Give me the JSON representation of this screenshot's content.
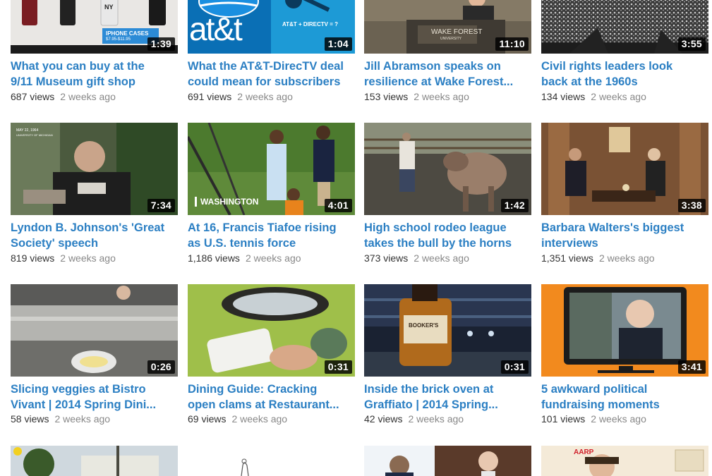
{
  "videos": [
    {
      "title_1": "What you can buy at the",
      "title_2": "9/11 Museum gift shop",
      "views": "687 views",
      "ago": "2 weeks ago",
      "duration": "1:39",
      "overlay": "IPHONE CASES",
      "overlay_sub": "$7.95-$11.95",
      "overlay_2": "NY"
    },
    {
      "title_1": "What the AT&T-DirecTV deal",
      "title_2": "could mean for subscribers",
      "views": "691 views",
      "ago": "2 weeks ago",
      "duration": "1:04",
      "overlay": "at&t",
      "overlay_sub": "AT&T + DIRECTV = ?"
    },
    {
      "title_1": "Jill Abramson speaks on",
      "title_2": "resilience at Wake Forest...",
      "views": "153 views",
      "ago": "2 weeks ago",
      "duration": "11:10",
      "overlay": "WAKE FOREST",
      "overlay_sub": "UNIVERSITY"
    },
    {
      "title_1": "Civil rights leaders look",
      "title_2": "back at the 1960s",
      "views": "134 views",
      "ago": "2 weeks ago",
      "duration": "3:55"
    },
    {
      "title_1": "Lyndon B. Johnson's 'Great",
      "title_2": "Society' speech",
      "views": "819 views",
      "ago": "2 weeks ago",
      "duration": "7:34",
      "overlay": "MAY 22, 1964",
      "overlay_sub": "UNIVERSITY OF MICHIGAN"
    },
    {
      "title_1": "At 16, Francis Tiafoe rising",
      "title_2": "as U.S. tennis force",
      "views": "1,186 views",
      "ago": "2 weeks ago",
      "duration": "4:01",
      "overlay": "WASHINGTON"
    },
    {
      "title_1": "High school rodeo league",
      "title_2": "takes the bull by the horns",
      "views": "373 views",
      "ago": "2 weeks ago",
      "duration": "1:42"
    },
    {
      "title_1": "Barbara Walters's biggest",
      "title_2": "interviews",
      "views": "1,351 views",
      "ago": "2 weeks ago",
      "duration": "3:38"
    },
    {
      "title_1": "Slicing veggies at Bistro",
      "title_2": "Vivant | 2014 Spring Dini...",
      "views": "58 views",
      "ago": "2 weeks ago",
      "duration": "0:26"
    },
    {
      "title_1": "Dining Guide: Cracking",
      "title_2": "open clams at Restaurant...",
      "views": "69 views",
      "ago": "2 weeks ago",
      "duration": "0:31"
    },
    {
      "title_1": "Inside the brick oven at",
      "title_2": "Graffiato | 2014 Spring...",
      "views": "42 views",
      "ago": "2 weeks ago",
      "duration": "0:31",
      "overlay": "BOOKER'S"
    },
    {
      "title_1": "5 awkward political",
      "title_2": "fundraising moments",
      "views": "101 views",
      "ago": "2 weeks ago",
      "duration": "3:41"
    },
    {
      "overlay": "AARP"
    }
  ],
  "colors": {
    "title_link": "#2b7fc3",
    "views_text": "#333333",
    "ago_text": "#888888",
    "duration_bg": "#000000"
  }
}
